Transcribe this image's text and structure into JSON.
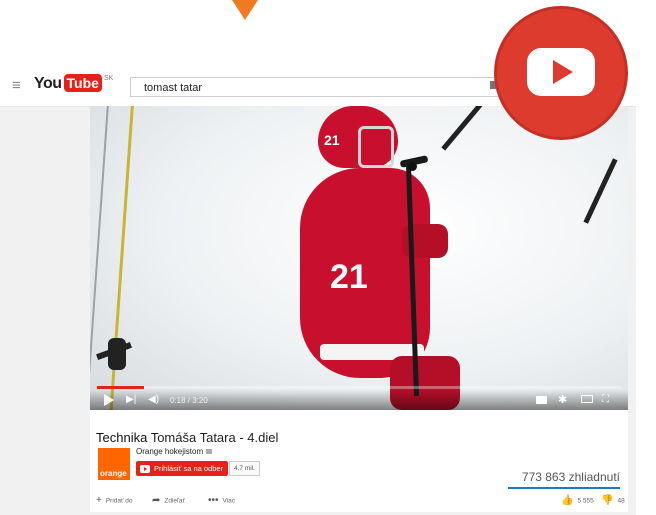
{
  "header": {
    "logo_you": "You",
    "logo_tube": "Tube",
    "logo_country": "SK",
    "search_value": "tomast tatar"
  },
  "player": {
    "jersey_number": "21",
    "time": "0:18 / 3:20",
    "progress": 0.09
  },
  "video": {
    "title_bold": "Technika",
    "title_rest": " Tomáša Tatara - 4.diel",
    "channel_name": "Orange hokejistom",
    "channel_logo_text": "orange",
    "subscribe_label": "Prihlásiť sa na odber",
    "subscriber_count": "4,7 mil.",
    "views": "773 863 zhliadnutí",
    "actions": {
      "add_label": "Pridať do",
      "share_label": "Zdieľať",
      "more_label": "Viac",
      "likes": "5 555",
      "dislikes": "48"
    }
  },
  "colors": {
    "youtube_red": "#e62117",
    "orange_brand": "#ff6600",
    "badge_red": "#dd3b2e",
    "accent_blue": "#167ac6"
  }
}
